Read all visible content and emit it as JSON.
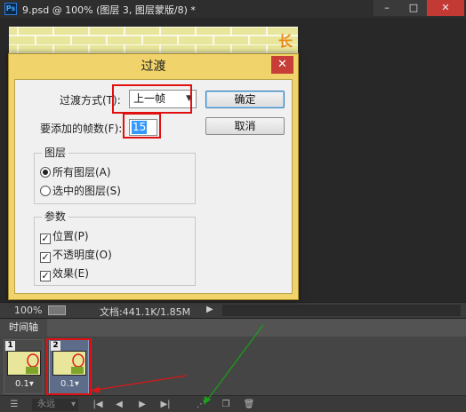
{
  "window": {
    "app_icon": "Ps",
    "title": "9.psd @ 100% (图层 3, 图层蒙版/8) *",
    "min_glyph": "–",
    "max_glyph": "□",
    "close_glyph": "✕"
  },
  "artwork": {
    "text_glyph": "长"
  },
  "status": {
    "zoom": "100%",
    "doc_info": "文档:441.1K/1.85M",
    "arrow": "▶"
  },
  "timeline": {
    "tab_label": "时间轴",
    "frames": [
      {
        "number": "1",
        "delay": "0.1▾"
      },
      {
        "number": "2",
        "delay": "0.1▾"
      }
    ],
    "loop": "永远",
    "loop_chevron": "▾"
  },
  "dialog": {
    "title": "过渡",
    "close_glyph": "✕",
    "tween_with_label": "过渡方式(T):",
    "tween_with_value": "上一帧",
    "frames_label": "要添加的帧数(F):",
    "frames_value": "15",
    "ok_label": "确定",
    "cancel_label": "取消",
    "layers_group": {
      "title": "图层",
      "options": [
        "所有图层(A)",
        "选中的图层(S)"
      ],
      "selected_index": 0
    },
    "params_group": {
      "title": "参数",
      "options": [
        {
          "label": "位置(P)",
          "checked": true
        },
        {
          "label": "不透明度(O)",
          "checked": true
        },
        {
          "label": "效果(E)",
          "checked": true
        }
      ]
    }
  },
  "colors": {
    "highlight": "#e01010",
    "dialog_frame": "#f0d36a",
    "selection": "#3399ff",
    "canvas_bg": "#e8e69a"
  }
}
